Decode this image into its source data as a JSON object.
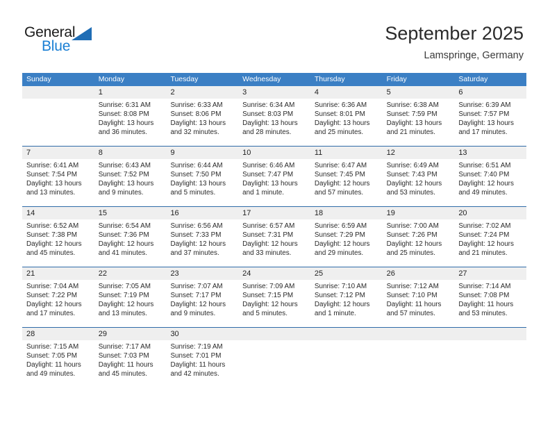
{
  "branding": {
    "name_part1": "General",
    "name_part2": "Blue",
    "accent_color": "#1a7fd4",
    "triangle_color": "#1f6db5"
  },
  "header": {
    "title": "September 2025",
    "subtitle": "Lamspringe, Germany"
  },
  "calendar": {
    "header_bg": "#3b7fc4",
    "daynum_bg": "#efefef",
    "separator_color": "#2f6ba8",
    "weekdays": [
      "Sunday",
      "Monday",
      "Tuesday",
      "Wednesday",
      "Thursday",
      "Friday",
      "Saturday"
    ],
    "weeks": [
      {
        "days": [
          {
            "date": "",
            "sunrise": "",
            "sunset": "",
            "daylight_1": "",
            "daylight_2": ""
          },
          {
            "date": "1",
            "sunrise": "Sunrise: 6:31 AM",
            "sunset": "Sunset: 8:08 PM",
            "daylight_1": "Daylight: 13 hours",
            "daylight_2": "and 36 minutes."
          },
          {
            "date": "2",
            "sunrise": "Sunrise: 6:33 AM",
            "sunset": "Sunset: 8:06 PM",
            "daylight_1": "Daylight: 13 hours",
            "daylight_2": "and 32 minutes."
          },
          {
            "date": "3",
            "sunrise": "Sunrise: 6:34 AM",
            "sunset": "Sunset: 8:03 PM",
            "daylight_1": "Daylight: 13 hours",
            "daylight_2": "and 28 minutes."
          },
          {
            "date": "4",
            "sunrise": "Sunrise: 6:36 AM",
            "sunset": "Sunset: 8:01 PM",
            "daylight_1": "Daylight: 13 hours",
            "daylight_2": "and 25 minutes."
          },
          {
            "date": "5",
            "sunrise": "Sunrise: 6:38 AM",
            "sunset": "Sunset: 7:59 PM",
            "daylight_1": "Daylight: 13 hours",
            "daylight_2": "and 21 minutes."
          },
          {
            "date": "6",
            "sunrise": "Sunrise: 6:39 AM",
            "sunset": "Sunset: 7:57 PM",
            "daylight_1": "Daylight: 13 hours",
            "daylight_2": "and 17 minutes."
          }
        ]
      },
      {
        "days": [
          {
            "date": "7",
            "sunrise": "Sunrise: 6:41 AM",
            "sunset": "Sunset: 7:54 PM",
            "daylight_1": "Daylight: 13 hours",
            "daylight_2": "and 13 minutes."
          },
          {
            "date": "8",
            "sunrise": "Sunrise: 6:43 AM",
            "sunset": "Sunset: 7:52 PM",
            "daylight_1": "Daylight: 13 hours",
            "daylight_2": "and 9 minutes."
          },
          {
            "date": "9",
            "sunrise": "Sunrise: 6:44 AM",
            "sunset": "Sunset: 7:50 PM",
            "daylight_1": "Daylight: 13 hours",
            "daylight_2": "and 5 minutes."
          },
          {
            "date": "10",
            "sunrise": "Sunrise: 6:46 AM",
            "sunset": "Sunset: 7:47 PM",
            "daylight_1": "Daylight: 13 hours",
            "daylight_2": "and 1 minute."
          },
          {
            "date": "11",
            "sunrise": "Sunrise: 6:47 AM",
            "sunset": "Sunset: 7:45 PM",
            "daylight_1": "Daylight: 12 hours",
            "daylight_2": "and 57 minutes."
          },
          {
            "date": "12",
            "sunrise": "Sunrise: 6:49 AM",
            "sunset": "Sunset: 7:43 PM",
            "daylight_1": "Daylight: 12 hours",
            "daylight_2": "and 53 minutes."
          },
          {
            "date": "13",
            "sunrise": "Sunrise: 6:51 AM",
            "sunset": "Sunset: 7:40 PM",
            "daylight_1": "Daylight: 12 hours",
            "daylight_2": "and 49 minutes."
          }
        ]
      },
      {
        "days": [
          {
            "date": "14",
            "sunrise": "Sunrise: 6:52 AM",
            "sunset": "Sunset: 7:38 PM",
            "daylight_1": "Daylight: 12 hours",
            "daylight_2": "and 45 minutes."
          },
          {
            "date": "15",
            "sunrise": "Sunrise: 6:54 AM",
            "sunset": "Sunset: 7:36 PM",
            "daylight_1": "Daylight: 12 hours",
            "daylight_2": "and 41 minutes."
          },
          {
            "date": "16",
            "sunrise": "Sunrise: 6:56 AM",
            "sunset": "Sunset: 7:33 PM",
            "daylight_1": "Daylight: 12 hours",
            "daylight_2": "and 37 minutes."
          },
          {
            "date": "17",
            "sunrise": "Sunrise: 6:57 AM",
            "sunset": "Sunset: 7:31 PM",
            "daylight_1": "Daylight: 12 hours",
            "daylight_2": "and 33 minutes."
          },
          {
            "date": "18",
            "sunrise": "Sunrise: 6:59 AM",
            "sunset": "Sunset: 7:29 PM",
            "daylight_1": "Daylight: 12 hours",
            "daylight_2": "and 29 minutes."
          },
          {
            "date": "19",
            "sunrise": "Sunrise: 7:00 AM",
            "sunset": "Sunset: 7:26 PM",
            "daylight_1": "Daylight: 12 hours",
            "daylight_2": "and 25 minutes."
          },
          {
            "date": "20",
            "sunrise": "Sunrise: 7:02 AM",
            "sunset": "Sunset: 7:24 PM",
            "daylight_1": "Daylight: 12 hours",
            "daylight_2": "and 21 minutes."
          }
        ]
      },
      {
        "days": [
          {
            "date": "21",
            "sunrise": "Sunrise: 7:04 AM",
            "sunset": "Sunset: 7:22 PM",
            "daylight_1": "Daylight: 12 hours",
            "daylight_2": "and 17 minutes."
          },
          {
            "date": "22",
            "sunrise": "Sunrise: 7:05 AM",
            "sunset": "Sunset: 7:19 PM",
            "daylight_1": "Daylight: 12 hours",
            "daylight_2": "and 13 minutes."
          },
          {
            "date": "23",
            "sunrise": "Sunrise: 7:07 AM",
            "sunset": "Sunset: 7:17 PM",
            "daylight_1": "Daylight: 12 hours",
            "daylight_2": "and 9 minutes."
          },
          {
            "date": "24",
            "sunrise": "Sunrise: 7:09 AM",
            "sunset": "Sunset: 7:15 PM",
            "daylight_1": "Daylight: 12 hours",
            "daylight_2": "and 5 minutes."
          },
          {
            "date": "25",
            "sunrise": "Sunrise: 7:10 AM",
            "sunset": "Sunset: 7:12 PM",
            "daylight_1": "Daylight: 12 hours",
            "daylight_2": "and 1 minute."
          },
          {
            "date": "26",
            "sunrise": "Sunrise: 7:12 AM",
            "sunset": "Sunset: 7:10 PM",
            "daylight_1": "Daylight: 11 hours",
            "daylight_2": "and 57 minutes."
          },
          {
            "date": "27",
            "sunrise": "Sunrise: 7:14 AM",
            "sunset": "Sunset: 7:08 PM",
            "daylight_1": "Daylight: 11 hours",
            "daylight_2": "and 53 minutes."
          }
        ]
      },
      {
        "days": [
          {
            "date": "28",
            "sunrise": "Sunrise: 7:15 AM",
            "sunset": "Sunset: 7:05 PM",
            "daylight_1": "Daylight: 11 hours",
            "daylight_2": "and 49 minutes."
          },
          {
            "date": "29",
            "sunrise": "Sunrise: 7:17 AM",
            "sunset": "Sunset: 7:03 PM",
            "daylight_1": "Daylight: 11 hours",
            "daylight_2": "and 45 minutes."
          },
          {
            "date": "30",
            "sunrise": "Sunrise: 7:19 AM",
            "sunset": "Sunset: 7:01 PM",
            "daylight_1": "Daylight: 11 hours",
            "daylight_2": "and 42 minutes."
          },
          {
            "date": "",
            "sunrise": "",
            "sunset": "",
            "daylight_1": "",
            "daylight_2": ""
          },
          {
            "date": "",
            "sunrise": "",
            "sunset": "",
            "daylight_1": "",
            "daylight_2": ""
          },
          {
            "date": "",
            "sunrise": "",
            "sunset": "",
            "daylight_1": "",
            "daylight_2": ""
          },
          {
            "date": "",
            "sunrise": "",
            "sunset": "",
            "daylight_1": "",
            "daylight_2": ""
          }
        ]
      }
    ]
  }
}
